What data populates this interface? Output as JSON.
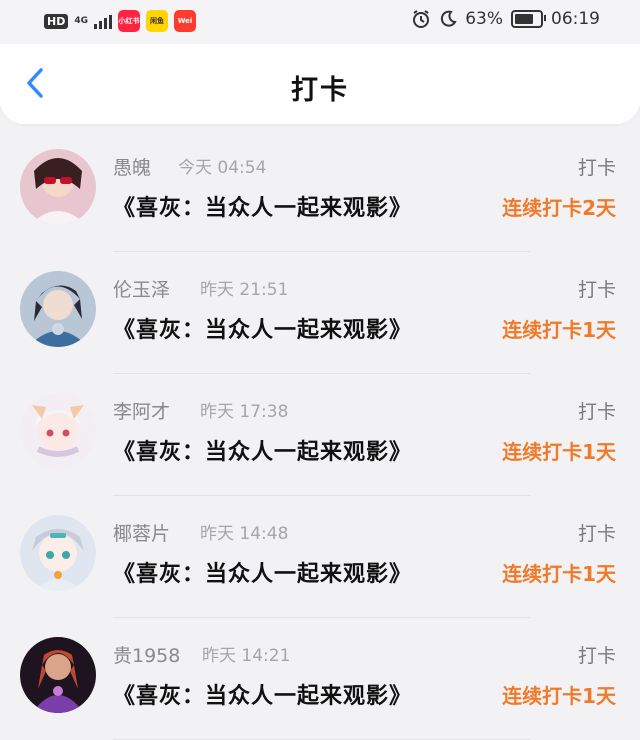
{
  "status_bar": {
    "hd": "HD",
    "network": "4G",
    "apps": [
      {
        "label": "小红书",
        "color": "#ff2442"
      },
      {
        "label": "闲鱼",
        "color": "#ffd400"
      },
      {
        "label": "Wei",
        "color": "#ff3b30"
      }
    ],
    "battery": "63%",
    "time": "06:19"
  },
  "header": {
    "title": "打卡"
  },
  "checkins": [
    {
      "name": "愚魄",
      "time": "今天 04:54",
      "action": "打卡",
      "movie": "《喜灰：当众人一起来观影》",
      "streak": "连续打卡2天"
    },
    {
      "name": "伦玉泽",
      "time": "昨天 21:51",
      "action": "打卡",
      "movie": "《喜灰：当众人一起来观影》",
      "streak": "连续打卡1天"
    },
    {
      "name": "李阿才",
      "time": "昨天 17:38",
      "action": "打卡",
      "movie": "《喜灰：当众人一起来观影》",
      "streak": "连续打卡1天"
    },
    {
      "name": "椰蓉片",
      "time": "昨天 14:48",
      "action": "打卡",
      "movie": "《喜灰：当众人一起来观影》",
      "streak": "连续打卡1天"
    },
    {
      "name": "贵1958",
      "time": "昨天 14:21",
      "action": "打卡",
      "movie": "《喜灰：当众人一起来观影》",
      "streak": "连续打卡1天"
    }
  ],
  "colors": {
    "accent": "#f07a2a",
    "back": "#2e8bff"
  }
}
